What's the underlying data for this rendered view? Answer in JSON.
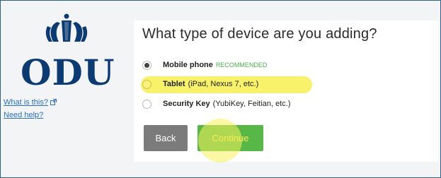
{
  "sidebar": {
    "logo_text": "ODU",
    "what_is_this": "What is this?",
    "need_help": "Need help?"
  },
  "prompt": {
    "title": "What type of device are you adding?",
    "options": [
      {
        "name": "Mobile phone",
        "detail": "",
        "badge": "RECOMMENDED",
        "selected": true
      },
      {
        "name": "Tablet",
        "detail": "(iPad, Nexus 7, etc.)",
        "badge": "",
        "selected": false,
        "highlighted": true
      },
      {
        "name": "Security Key",
        "detail": "(YubiKey, Feitian, etc.)",
        "badge": "",
        "selected": false
      }
    ]
  },
  "buttons": {
    "back": "Back",
    "continue": "Continue"
  },
  "colors": {
    "brand_navy": "#0c3b73",
    "link": "#2a6fbd",
    "continue_bg": "#57b848",
    "back_bg": "#7b7b7b",
    "highlight": "#f7f26a"
  }
}
